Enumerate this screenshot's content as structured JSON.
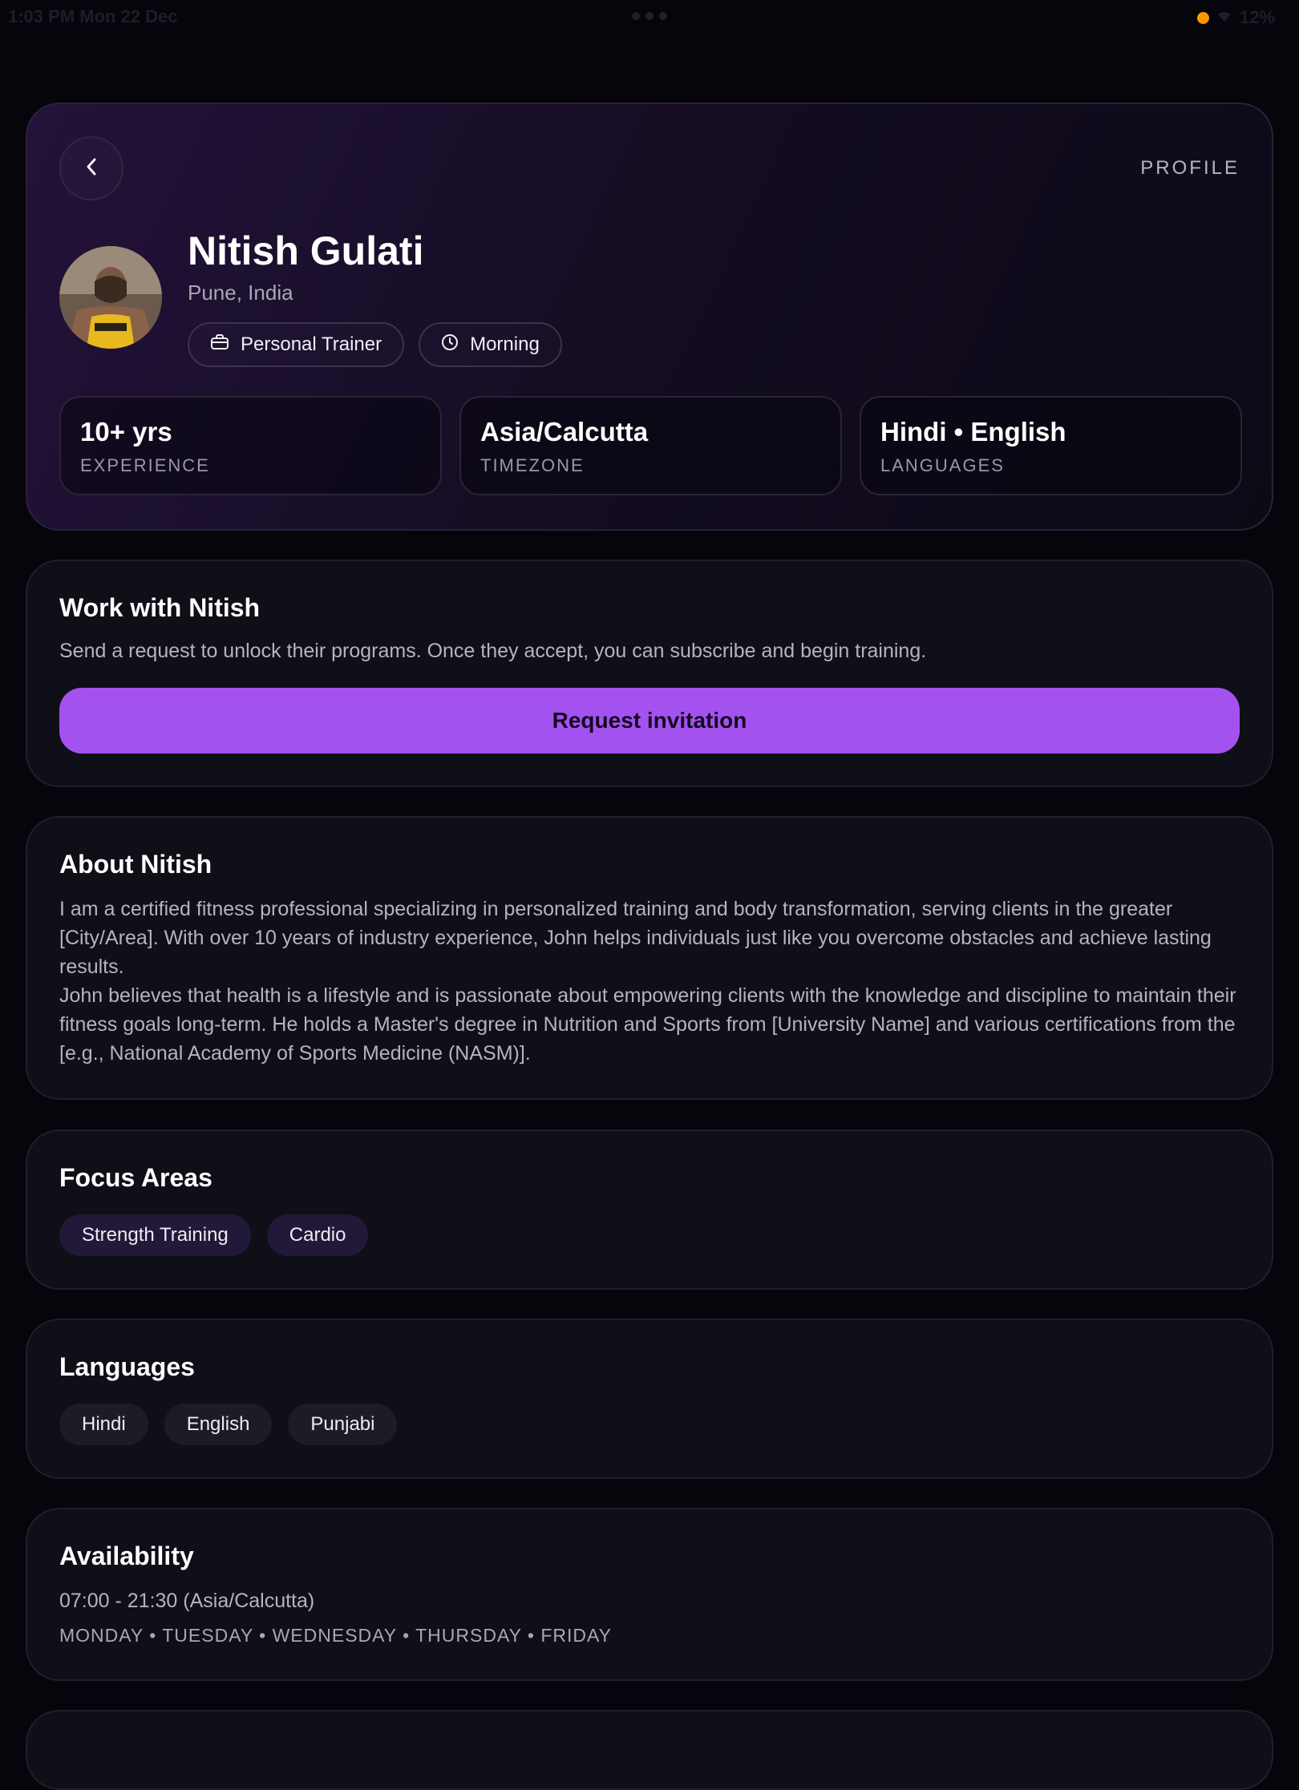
{
  "status_bar": {
    "time": "1:03 PM  Mon 22 Dec",
    "battery": "12%"
  },
  "header": {
    "page_label": "PROFILE"
  },
  "profile": {
    "name": "Nitish Gulati",
    "location": "Pune, India",
    "chips": [
      {
        "label": "Personal Trainer",
        "icon": "briefcase-icon"
      },
      {
        "label": "Morning",
        "icon": "clock-icon"
      }
    ],
    "stats": [
      {
        "value": "10+ yrs",
        "label": "EXPERIENCE"
      },
      {
        "value": "Asia/Calcutta",
        "label": "TIMEZONE"
      },
      {
        "value": "Hindi • English",
        "label": "LANGUAGES"
      }
    ]
  },
  "work": {
    "title": "Work with Nitish",
    "description": "Send a request to unlock their programs. Once they accept, you can subscribe and begin training.",
    "cta_label": "Request invitation"
  },
  "about": {
    "title": "About Nitish",
    "paragraph_1": "I am a certified fitness professional specializing in personalized training and body transformation, serving clients in the greater [City/Area]. With over 10 years of industry experience, John helps individuals just like you overcome obstacles and achieve lasting results.",
    "paragraph_2": "John believes that health is a lifestyle and is passionate about empowering clients with the knowledge and discipline to maintain their fitness goals long-term. He holds a Master's degree in Nutrition and Sports from [University Name] and various certifications from the [e.g., National Academy of Sports Medicine (NASM)]."
  },
  "focus_areas": {
    "title": "Focus Areas",
    "items": [
      "Strength Training",
      "Cardio"
    ]
  },
  "languages": {
    "title": "Languages",
    "items": [
      "Hindi",
      "English",
      "Punjabi"
    ]
  },
  "availability": {
    "title": "Availability",
    "hours": "07:00 - 21:30 (Asia/Calcutta)",
    "days": "MONDAY • TUESDAY • WEDNESDAY • THURSDAY • FRIDAY"
  },
  "colors": {
    "accent": "#a352f0",
    "background": "#05050b",
    "card": "#0f0f18",
    "status_dot": "#ff9500"
  }
}
